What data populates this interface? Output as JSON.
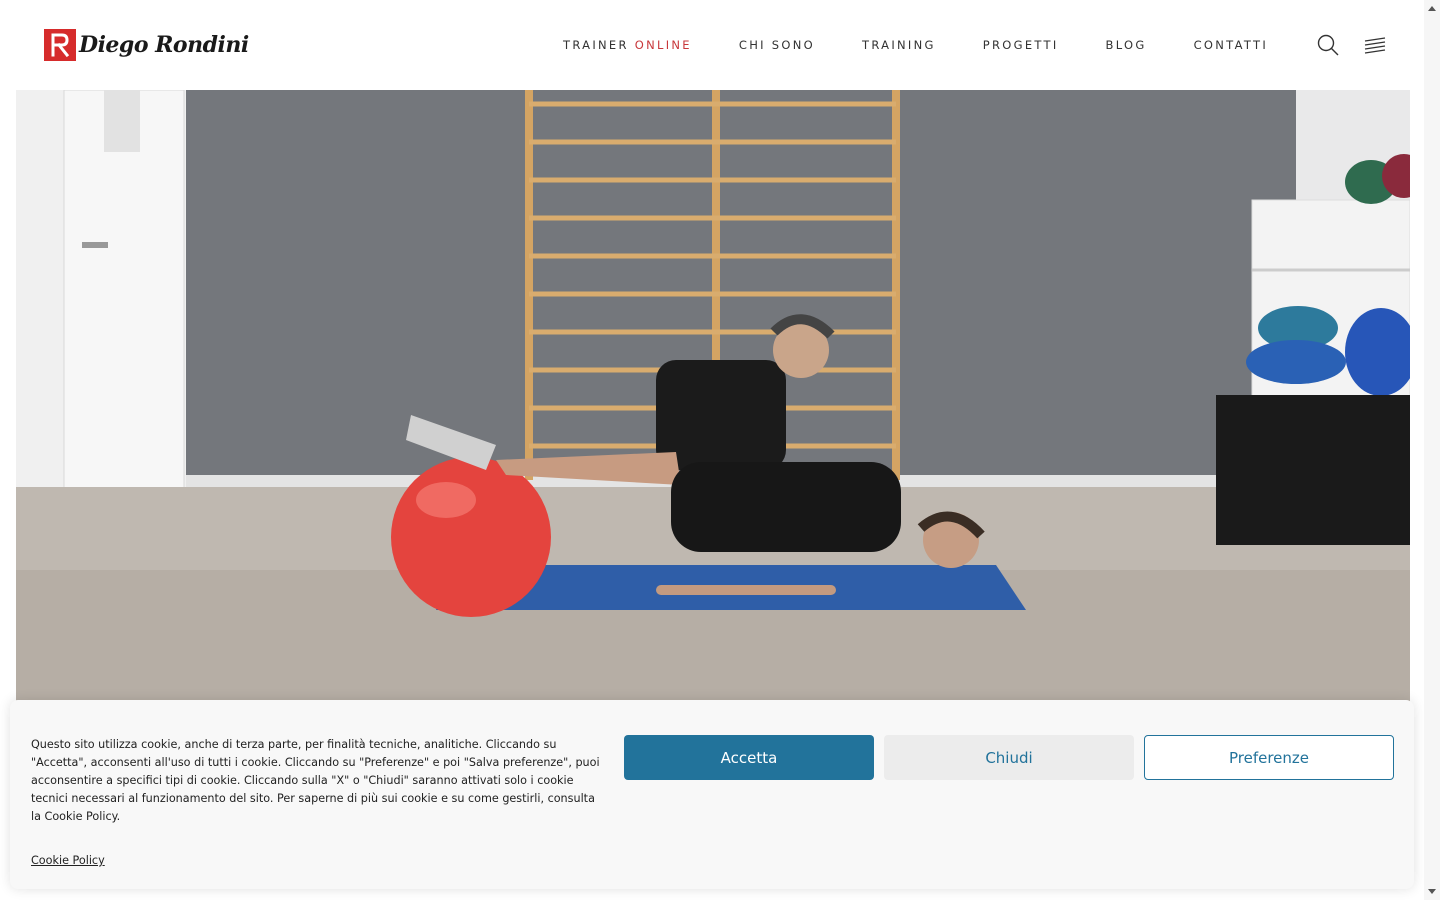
{
  "header": {
    "logo_text": "Diego Rondini",
    "nav": [
      {
        "label": "TRAINER",
        "accent": "ONLINE"
      },
      {
        "label": "CHI SONO"
      },
      {
        "label": "TRAINING"
      },
      {
        "label": "PROGETTI"
      },
      {
        "label": "BLOG"
      },
      {
        "label": "CONTATTI"
      }
    ],
    "icons": {
      "search": "search-icon",
      "menu": "menu-icon"
    }
  },
  "hero": {
    "image": "Trainer assisting a man doing a glute bridge with legs on a red exercise ball in a gym"
  },
  "cookie_banner": {
    "text": "Questo sito utilizza cookie, anche di terza parte, per finalità tecniche, analitiche. Cliccando su \"Accetta\", acconsenti all'uso di tutti i cookie. Cliccando su \"Preferenze\" e poi \"Salva preferenze\", puoi acconsentire a specifici tipi di cookie. Cliccando sulla \"X\" o \"Chiudi\" saranno attivati solo i cookie tecnici necessari al funzionamento del sito. Per saperne di più sui cookie e su come gestirli, consulta la Cookie Policy.",
    "policy_link": "Cookie Policy",
    "accept_label": "Accetta",
    "close_label": "Chiudi",
    "prefs_label": "Preferenze"
  },
  "colors": {
    "brand_red": "#d62b2b",
    "nav_accent": "#c8373a",
    "button_blue": "#22739b"
  }
}
